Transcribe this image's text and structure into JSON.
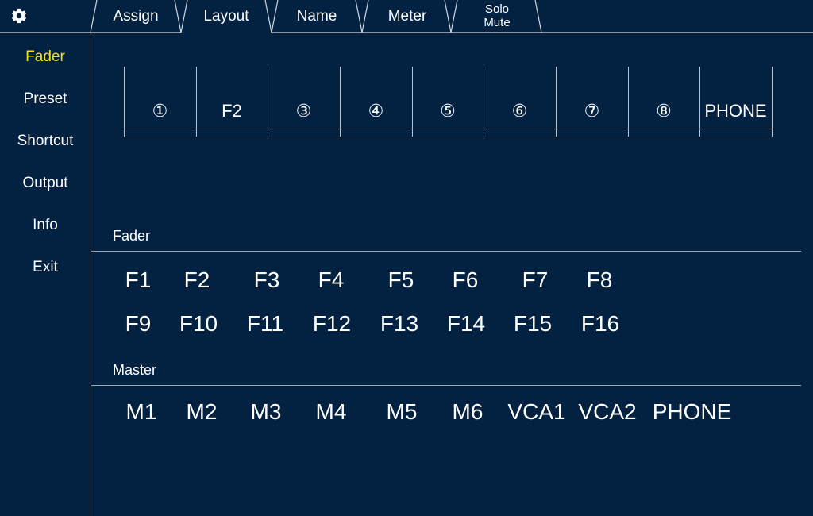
{
  "header": {
    "settings_icon": "gear-icon",
    "tabs": [
      {
        "label": "Assign"
      },
      {
        "label": "Layout"
      },
      {
        "label": "Name"
      },
      {
        "label": "Meter"
      },
      {
        "label_line1": "Solo",
        "label_line2": "Mute"
      }
    ],
    "active_tab": "Layout"
  },
  "sidebar": {
    "items": [
      {
        "label": "Fader",
        "active": true
      },
      {
        "label": "Preset"
      },
      {
        "label": "Shortcut"
      },
      {
        "label": "Output"
      },
      {
        "label": "Info"
      },
      {
        "label": "Exit"
      }
    ]
  },
  "layout": {
    "slots": [
      "①",
      "F2",
      "③",
      "④",
      "⑤",
      "⑥",
      "⑦",
      "⑧",
      "PHONE"
    ]
  },
  "fader_section": {
    "label": "Fader",
    "row1": [
      "F1",
      "F2",
      "F3",
      "F4",
      "F5",
      "F6",
      "F7",
      "F8"
    ],
    "row2": [
      "F9",
      "F10",
      "F11",
      "F12",
      "F13",
      "F14",
      "F15",
      "F16"
    ]
  },
  "master_section": {
    "label": "Master",
    "items": [
      "M1",
      "M2",
      "M3",
      "M4",
      "M5",
      "M6",
      "VCA1",
      "VCA2",
      "PHONE"
    ]
  },
  "colors": {
    "background": "#032141",
    "active_text": "#f2e41a",
    "text": "#ffffff",
    "lines": "#cfd6de"
  }
}
